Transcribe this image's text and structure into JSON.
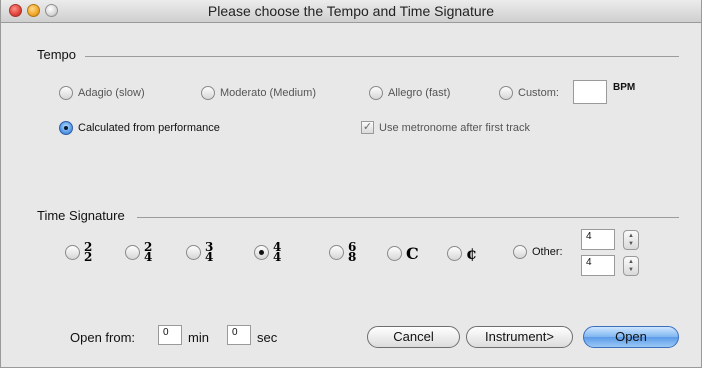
{
  "window": {
    "title": "Please choose the Tempo and Time Signature"
  },
  "tempo": {
    "heading": "Tempo",
    "options": [
      {
        "label": "Adagio (slow)"
      },
      {
        "label": "Moderato (Medium)"
      },
      {
        "label": "Allegro (fast)"
      },
      {
        "label": "Custom:"
      }
    ],
    "custom_value": "",
    "bpm_label": "BPM",
    "calculated_label": "Calculated from performance",
    "metronome_label": "Use metronome after first track",
    "metronome_checked": true
  },
  "time_signature": {
    "heading": "Time Signature",
    "fractions": [
      {
        "num": "2",
        "den": "2"
      },
      {
        "num": "2",
        "den": "4"
      },
      {
        "num": "3",
        "den": "4"
      },
      {
        "num": "4",
        "den": "4"
      },
      {
        "num": "6",
        "den": "8"
      }
    ],
    "common_symbol": "C",
    "cut_symbol": "¢",
    "selected": "4/4",
    "other_label": "Other:",
    "other_numerator": "4",
    "other_denominator": "4"
  },
  "open_from": {
    "label": "Open from:",
    "min_value": "0",
    "min_label": "min",
    "sec_value": "0",
    "sec_label": "sec"
  },
  "buttons": {
    "cancel": "Cancel",
    "instrument": "Instrument>",
    "open": "Open"
  }
}
